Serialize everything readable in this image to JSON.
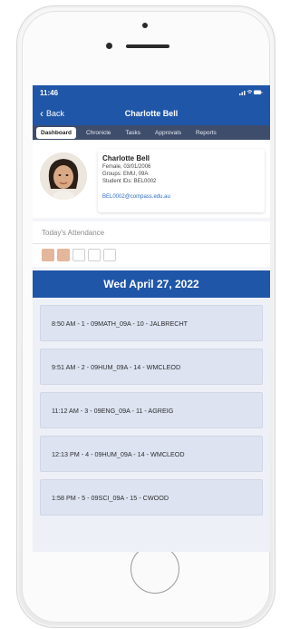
{
  "status": {
    "time": "11:46",
    "icons": "signal wifi battery"
  },
  "nav": {
    "back_label": "Back",
    "title": "Charlotte Bell"
  },
  "tabs": [
    "Dashboard",
    "Chronicle",
    "Tasks",
    "Approvals",
    "Reports"
  ],
  "profile": {
    "name": "Charlotte Bell",
    "gender_dob": "Female, 03/01/2006",
    "groups": "Groups: EMU, 09A",
    "student_ids": "Student IDs: BEL0002",
    "email": "BEL0002@compass.edu.au"
  },
  "attendance": {
    "label": "Today's Attendance",
    "boxes": [
      true,
      true,
      false,
      false,
      false
    ]
  },
  "date": "Wed April 27, 2022",
  "periods": [
    "8:50 AM - 1 - 09MATH_09A - 10 - JALBRECHT",
    "9:51 AM - 2 - 09HUM_09A - 14 - WMCLEOD",
    "11:12 AM - 3 - 09ENG_09A - 11 - AGREIG",
    "12:13 PM - 4 - 09HUM_09A - 14 - WMCLEOD",
    "1:58 PM - 5 - 09SCI_09A - 15 - CWOOD"
  ],
  "colors": {
    "header": "#1f56a8",
    "tabbar": "#3f4d6c",
    "attendance_filled": "#e4b79c",
    "period_bg": "#dde3f1"
  }
}
